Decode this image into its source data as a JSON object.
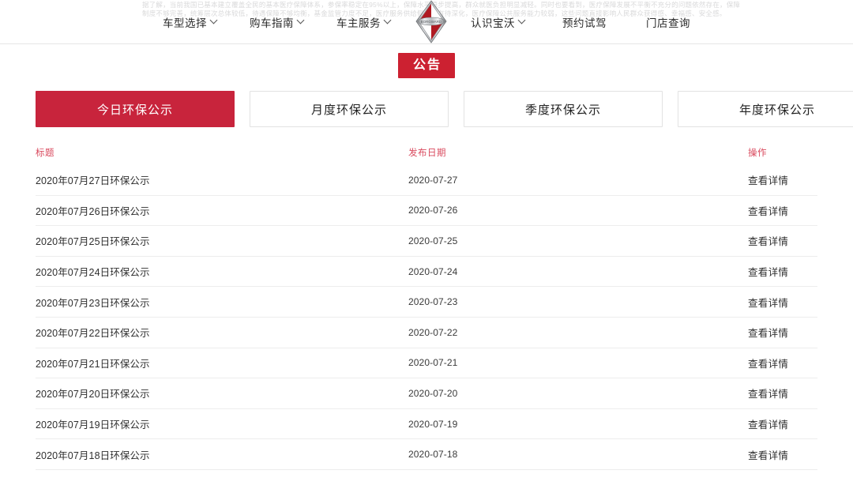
{
  "header": {
    "watermark": "据了解，当前我国已基本建立覆盖全民的基本医疗保障体系，参保率稳定在95%以上，保障水平稳步提高，群众就医负担明显减轻。同时也要看到，医疗保障发展不平衡不充分的问题依然存在，保障制度不够完善，统筹层次总体较低，待遇保障不够均衡，基金监管力度不足，医疗服务供给侧改革有待深化，医疗保障公共服务能力较弱，这些问题直接影响人民群众获得感、幸福感、安全感。",
    "logo_name": "borgward-emblem",
    "nav": [
      {
        "label": "车型选择",
        "has_dropdown": true
      },
      {
        "label": "购车指南",
        "has_dropdown": true
      },
      {
        "label": "车主服务",
        "has_dropdown": true
      },
      {
        "label": "认识宝沃",
        "has_dropdown": true
      },
      {
        "label": "预约试驾",
        "has_dropdown": false
      },
      {
        "label": "门店查询",
        "has_dropdown": false
      }
    ]
  },
  "announce": {
    "badge_label": "公告",
    "badge_color": "#cc2131"
  },
  "tabs": [
    {
      "label": "今日环保公示",
      "active": true
    },
    {
      "label": "月度环保公示",
      "active": false
    },
    {
      "label": "季度环保公示",
      "active": false
    },
    {
      "label": "年度环保公示",
      "active": false
    }
  ],
  "table": {
    "headers": {
      "title": "标题",
      "date": "发布日期",
      "action": "操作"
    },
    "header_color": "#d94a5e",
    "action_label": "查看详情",
    "rows": [
      {
        "title": "2020年07月27日环保公示",
        "date": "2020-07-27",
        "action": "查看详情"
      },
      {
        "title": "2020年07月26日环保公示",
        "date": "2020-07-26",
        "action": "查看详情"
      },
      {
        "title": "2020年07月25日环保公示",
        "date": "2020-07-25",
        "action": "查看详情"
      },
      {
        "title": "2020年07月24日环保公示",
        "date": "2020-07-24",
        "action": "查看详情"
      },
      {
        "title": "2020年07月23日环保公示",
        "date": "2020-07-23",
        "action": "查看详情"
      },
      {
        "title": "2020年07月22日环保公示",
        "date": "2020-07-22",
        "action": "查看详情"
      },
      {
        "title": "2020年07月21日环保公示",
        "date": "2020-07-21",
        "action": "查看详情"
      },
      {
        "title": "2020年07月20日环保公示",
        "date": "2020-07-20",
        "action": "查看详情"
      },
      {
        "title": "2020年07月19日环保公示",
        "date": "2020-07-19",
        "action": "查看详情"
      },
      {
        "title": "2020年07月18日环保公示",
        "date": "2020-07-18",
        "action": "查看详情"
      }
    ]
  }
}
